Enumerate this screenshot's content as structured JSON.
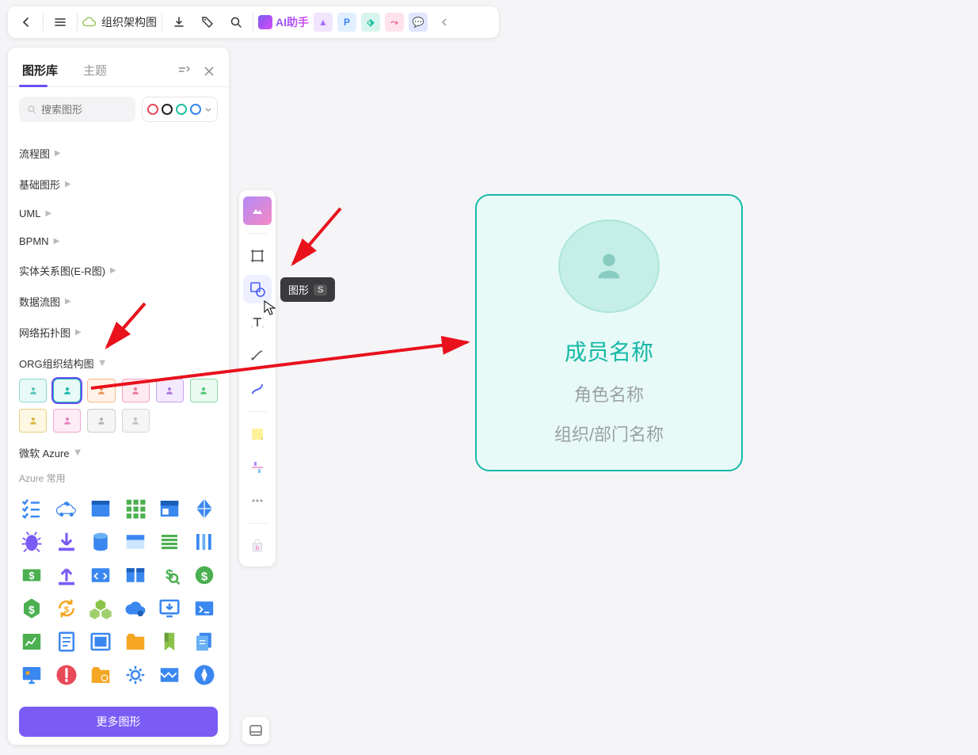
{
  "topbar": {
    "title": "组织架构图",
    "ai_label": "AI助手"
  },
  "panel": {
    "tab_shapes": "图形库",
    "tab_theme": "主题",
    "search_placeholder": "搜索图形",
    "categories": [
      "流程图",
      "基础图形",
      "UML",
      "BPMN",
      "实体关系图(E-R图)",
      "数据流图",
      "网络拓扑图",
      "ORG组织结构图",
      "微软 Azure"
    ],
    "azure_sub": "Azure 常用",
    "more_btn": "更多图形"
  },
  "org_colors": [
    {
      "name": "teal",
      "border": "#8dd7d0",
      "bg": "#e8faf7",
      "icon": "#5ac4b6"
    },
    {
      "name": "teal-sel",
      "border": "#15b8a6",
      "bg": "#e8faf7",
      "icon": "#15b8a6"
    },
    {
      "name": "orange",
      "border": "#f5b889",
      "bg": "#fff3e9",
      "icon": "#e8935a"
    },
    {
      "name": "pink",
      "border": "#f5a2bb",
      "bg": "#ffeaf1",
      "icon": "#e8769e"
    },
    {
      "name": "purple",
      "border": "#c7a2f0",
      "bg": "#f3eaff",
      "icon": "#a876e0"
    },
    {
      "name": "green",
      "border": "#8ed9a5",
      "bg": "#eafaf0",
      "icon": "#4ec776"
    },
    {
      "name": "yellow",
      "border": "#e9cf80",
      "bg": "#fdf7e4",
      "icon": "#d9b645"
    },
    {
      "name": "pink2",
      "border": "#f0a9d4",
      "bg": "#fdebf6",
      "icon": "#e57fc0"
    },
    {
      "name": "gray",
      "border": "#cfcfcf",
      "bg": "#f5f5f5",
      "icon": "#b5b5b5"
    },
    {
      "name": "gray2",
      "border": "#d7d7d7",
      "bg": "#f5f5f5",
      "icon": "#c0c0c0"
    }
  ],
  "tooltip": {
    "label": "图形",
    "shortcut": "S"
  },
  "card": {
    "member": "成员名称",
    "role": "角色名称",
    "org": "组织/部门名称"
  },
  "color_picker": [
    "#e84a5a",
    "#222222",
    "#1fbfa0",
    "#3a87f0"
  ],
  "azure_icons": [
    {
      "name": "checklist",
      "color": "#3a87f0"
    },
    {
      "name": "cloud-node",
      "color": "#3a87f0"
    },
    {
      "name": "window",
      "color": "#3a87f0"
    },
    {
      "name": "grid",
      "color": "#4caf50"
    },
    {
      "name": "panel",
      "color": "#3a87f0"
    },
    {
      "name": "diamond",
      "color": "#3a87f0"
    },
    {
      "name": "bug",
      "color": "#7a5cf5"
    },
    {
      "name": "download-arrow",
      "color": "#7a5cf5"
    },
    {
      "name": "database",
      "color": "#3a87f0"
    },
    {
      "name": "header",
      "color": "#3a87f0"
    },
    {
      "name": "lines",
      "color": "#4caf50"
    },
    {
      "name": "bars",
      "color": "#3a87f0"
    },
    {
      "name": "dollar",
      "color": "#4caf50"
    },
    {
      "name": "upload",
      "color": "#7a5cf5"
    },
    {
      "name": "code",
      "color": "#3a87f0"
    },
    {
      "name": "dual-panel",
      "color": "#3a87f0"
    },
    {
      "name": "dollar-search",
      "color": "#4caf50"
    },
    {
      "name": "dollar-circle",
      "color": "#4caf50"
    },
    {
      "name": "hex-dollar",
      "color": "#4caf50"
    },
    {
      "name": "dollar-cycle",
      "color": "#f5a623"
    },
    {
      "name": "cubes",
      "color": "#8bc34a"
    },
    {
      "name": "cloud",
      "color": "#3a87f0"
    },
    {
      "name": "monitor-down",
      "color": "#3a87f0"
    },
    {
      "name": "terminal",
      "color": "#3a87f0"
    },
    {
      "name": "chart",
      "color": "#4caf50"
    },
    {
      "name": "document",
      "color": "#3a87f0"
    },
    {
      "name": "image",
      "color": "#3a87f0"
    },
    {
      "name": "folder",
      "color": "#f5a623"
    },
    {
      "name": "bookmark",
      "color": "#8bc34a"
    },
    {
      "name": "docs",
      "color": "#3a87f0"
    },
    {
      "name": "screen",
      "color": "#3a87f0"
    },
    {
      "name": "alert",
      "color": "#e84a5a"
    },
    {
      "name": "folder-gear",
      "color": "#f5a623"
    },
    {
      "name": "gear",
      "color": "#3a87f0"
    },
    {
      "name": "pattern",
      "color": "#3a87f0"
    },
    {
      "name": "compass",
      "color": "#3a87f0"
    }
  ]
}
